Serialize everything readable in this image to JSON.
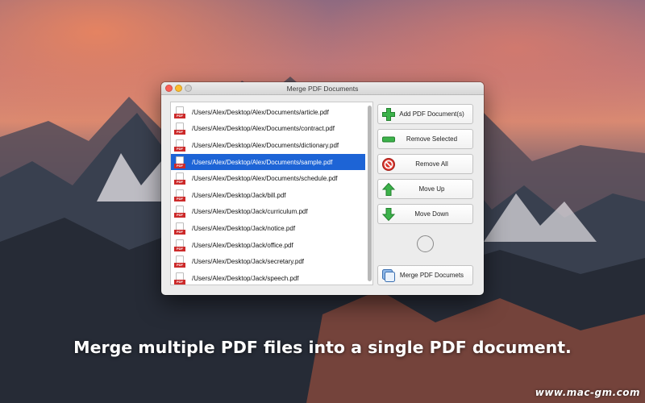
{
  "window": {
    "title": "Merge PDF Documents"
  },
  "files": [
    {
      "path": "/Users/Alex/Desktop/Alex/Documents/article.pdf",
      "icon": "pdf-file-icon"
    },
    {
      "path": "/Users/Alex/Desktop/Alex/Documents/contract.pdf",
      "icon": "pdf-file-icon"
    },
    {
      "path": "/Users/Alex/Desktop/Alex/Documents/dictionary.pdf",
      "icon": "pdf-file-icon"
    },
    {
      "path": "/Users/Alex/Desktop/Alex/Documents/sample.pdf",
      "icon": "pdf-file-icon",
      "selected": true
    },
    {
      "path": "/Users/Alex/Desktop/Alex/Documents/schedule.pdf",
      "icon": "pdf-file-icon"
    },
    {
      "path": "/Users/Alex/Desktop/Jack/bill.pdf",
      "icon": "pdf-file-icon"
    },
    {
      "path": "/Users/Alex/Desktop/Jack/curriculum.pdf",
      "icon": "pdf-file-icon"
    },
    {
      "path": "/Users/Alex/Desktop/Jack/notice.pdf",
      "icon": "pdf-file-icon"
    },
    {
      "path": "/Users/Alex/Desktop/Jack/office.pdf",
      "icon": "pdf-file-icon"
    },
    {
      "path": "/Users/Alex/Desktop/Jack/secretary.pdf",
      "icon": "pdf-file-icon"
    },
    {
      "path": "/Users/Alex/Desktop/Jack/speech.pdf",
      "icon": "pdf-file-icon"
    }
  ],
  "buttons": {
    "add": {
      "label": "Add PDF Document(s)",
      "icon": "plus-icon"
    },
    "remove_selected": {
      "label": "Remove Selected",
      "icon": "minus-icon"
    },
    "remove_all": {
      "label": "Remove All",
      "icon": "prohibited-icon"
    },
    "move_up": {
      "label": "Move Up",
      "icon": "arrow-up-icon"
    },
    "move_down": {
      "label": "Move Down",
      "icon": "arrow-down-icon"
    },
    "merge": {
      "label": "Merge PDF Documets",
      "icon": "stacked-pages-icon"
    }
  },
  "caption": "Merge multiple PDF files into a single PDF document.",
  "watermark": "www.mac-gm.com",
  "colors": {
    "selection": "#1d64d6",
    "add_green": "#3cb24a",
    "remove_red": "#d9352d",
    "pdf_red": "#cc2a2a"
  }
}
